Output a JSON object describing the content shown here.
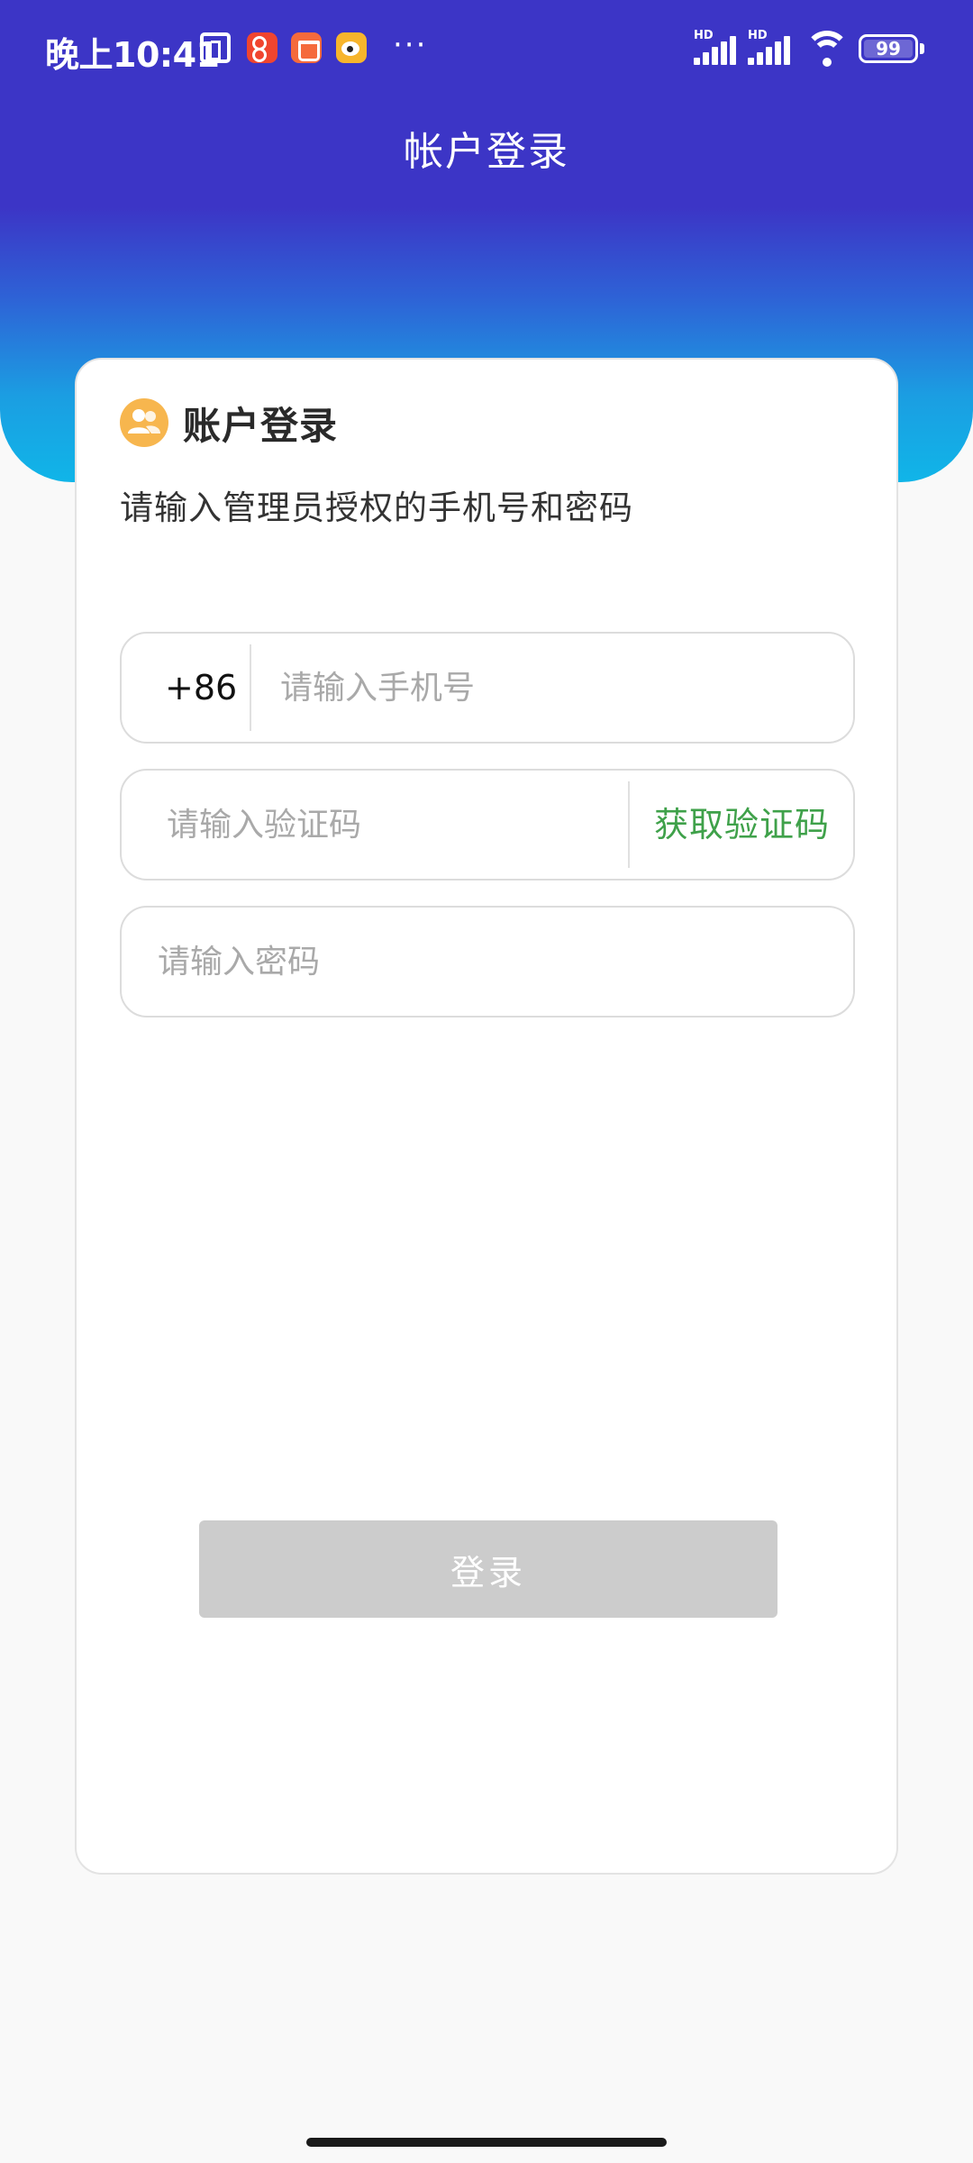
{
  "status_bar": {
    "time": "晚上10:41",
    "dots": "···",
    "network_label_1": "HD",
    "network_label_2": "HD",
    "battery": "99"
  },
  "header": {
    "title": "帐户登录"
  },
  "card": {
    "title": "账户登录",
    "subtitle": "请输入管理员授权的手机号和密码",
    "icon": "users-icon",
    "phone": {
      "prefix": "+86",
      "value": "",
      "placeholder": "请输入手机号"
    },
    "code": {
      "value": "",
      "placeholder": "请输入验证码",
      "action_label": "获取验证码"
    },
    "password": {
      "value": "",
      "placeholder": "请输入密码"
    },
    "login_label": "登录"
  },
  "colors": {
    "header_top": "#3c35c6",
    "header_bottom": "#10b5e8",
    "badge": "#f7b64e",
    "action_green": "#3fa14a",
    "button_disabled": "#cccccc"
  }
}
